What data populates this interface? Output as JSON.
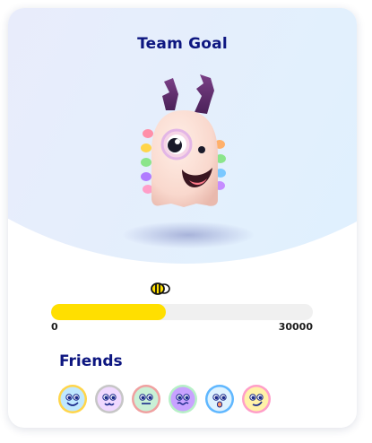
{
  "team_goal": {
    "title": "Team Goal"
  },
  "progress": {
    "min_label": "0",
    "max_label": "30000",
    "fill_fraction": 0.44,
    "fill_color": "#ffdf00",
    "icon": "bee-icon"
  },
  "friends": {
    "heading": "Friends",
    "avatars": [
      {
        "icon": "friend-avatar-icon",
        "color": "#bfe8ff",
        "rim": "#ffd54a",
        "face": "smile"
      },
      {
        "icon": "friend-avatar-icon",
        "color": "#f0d9ff",
        "rim": "#c6c6c6",
        "face": "cat"
      },
      {
        "icon": "friend-avatar-icon",
        "color": "#c9f0d6",
        "rim": "#f0a0a0",
        "face": "flat"
      },
      {
        "icon": "friend-avatar-icon",
        "color": "#c8a2ff",
        "rim": "#b7f0c7",
        "face": "wavy"
      },
      {
        "icon": "friend-avatar-icon",
        "color": "#dff3ff",
        "rim": "#5fb7ff",
        "face": "oh"
      },
      {
        "icon": "friend-avatar-icon",
        "color": "#fff2a8",
        "rim": "#ff9ec8",
        "face": "smirk"
      }
    ]
  },
  "colors": {
    "heading": "#0d1680",
    "track": "#f0f0f0"
  }
}
